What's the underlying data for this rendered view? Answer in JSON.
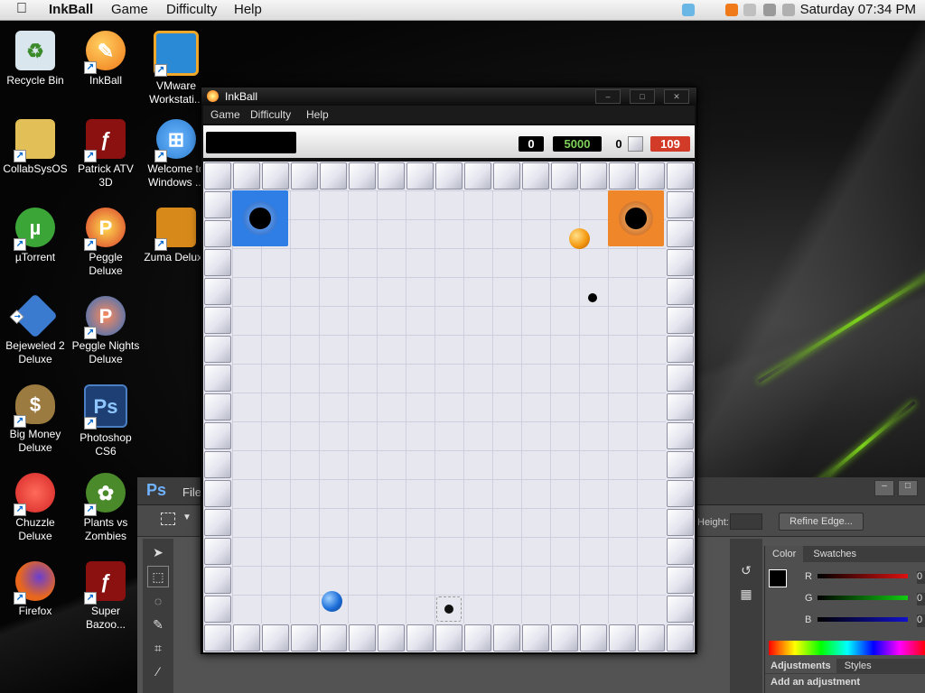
{
  "menubar": {
    "app_name": "InkBall",
    "menus": [
      "Game",
      "Difficulty",
      "Help"
    ],
    "clock": "Saturday 07:34 PM"
  },
  "desktop_icons": [
    {
      "label": "Recycle Bin",
      "icon": "recycle-bin-icon",
      "color": "#d9e6ee"
    },
    {
      "label": "InkBall",
      "icon": "inkball-icon",
      "color": "#f07a1a"
    },
    {
      "label": "VMware Workstati...",
      "icon": "vmware-icon",
      "color": "#2a8ad6"
    },
    {
      "label": "CollabSysOS",
      "icon": "folder-icon",
      "color": "#e3c057"
    },
    {
      "label": "Patrick ATV 3D",
      "icon": "flash-icon",
      "color": "#8b1010"
    },
    {
      "label": "Welcome to Windows ...",
      "icon": "windows-icon",
      "color": "#2f7fd3"
    },
    {
      "label": "µTorrent",
      "icon": "utorrent-icon",
      "color": "#3ba538"
    },
    {
      "label": "Peggle Deluxe",
      "icon": "peggle-icon",
      "color": "#d93b2a"
    },
    {
      "label": "Zuma Deluxe",
      "icon": "zuma-icon",
      "color": "#d7891a"
    },
    {
      "label": "Bejeweled 2 Deluxe",
      "icon": "bejeweled-icon",
      "color": "#3a7bd0"
    },
    {
      "label": "Peggle Nights Deluxe",
      "icon": "peggle-nights-icon",
      "color": "#2a6fc4"
    },
    {
      "label": "Big Money Deluxe",
      "icon": "money-bag-icon",
      "color": "#9b7b40"
    },
    {
      "label": "Photoshop CS6",
      "icon": "photoshop-icon",
      "color": "#1d3f74"
    },
    {
      "label": "Chuzzle Deluxe",
      "icon": "chuzzle-icon",
      "color": "#d42525"
    },
    {
      "label": "Plants vs Zombies",
      "icon": "plants-vs-zombies-icon",
      "color": "#4a8a2a"
    },
    {
      "label": "Firefox",
      "icon": "firefox-icon",
      "color": "#e8671c"
    },
    {
      "label": "Super Bazoo...",
      "icon": "flash-icon",
      "color": "#8b1010"
    }
  ],
  "photoshop": {
    "logo": "Ps",
    "file_menu": "File",
    "height_label": "Height:",
    "refine_edge": "Refine Edge...",
    "panel_tabs": [
      "Color",
      "Swatches"
    ],
    "sliders": [
      {
        "label": "R",
        "value": "0",
        "color": "#d11"
      },
      {
        "label": "G",
        "value": "0",
        "color": "#1c1"
      },
      {
        "label": "B",
        "value": "0",
        "color": "#11c"
      }
    ],
    "adj_tabs": [
      "Adjustments",
      "Styles"
    ],
    "adj_hint": "Add an adjustment"
  },
  "inkball": {
    "title": "InkBall",
    "menus": [
      "Game",
      "Difficulty",
      "Help"
    ],
    "hud": {
      "score": "0",
      "high_score": "5000",
      "balls_sunk": "0",
      "timer": "109"
    },
    "colors": {
      "blue_hole": "#2f7ee6",
      "orange_hole": "#f0862a",
      "blue_ball": "#1d6fd9",
      "orange_ball": "#f59a12",
      "timer_bg": "#d23b28",
      "high_score_fg": "#7fd05a"
    }
  }
}
